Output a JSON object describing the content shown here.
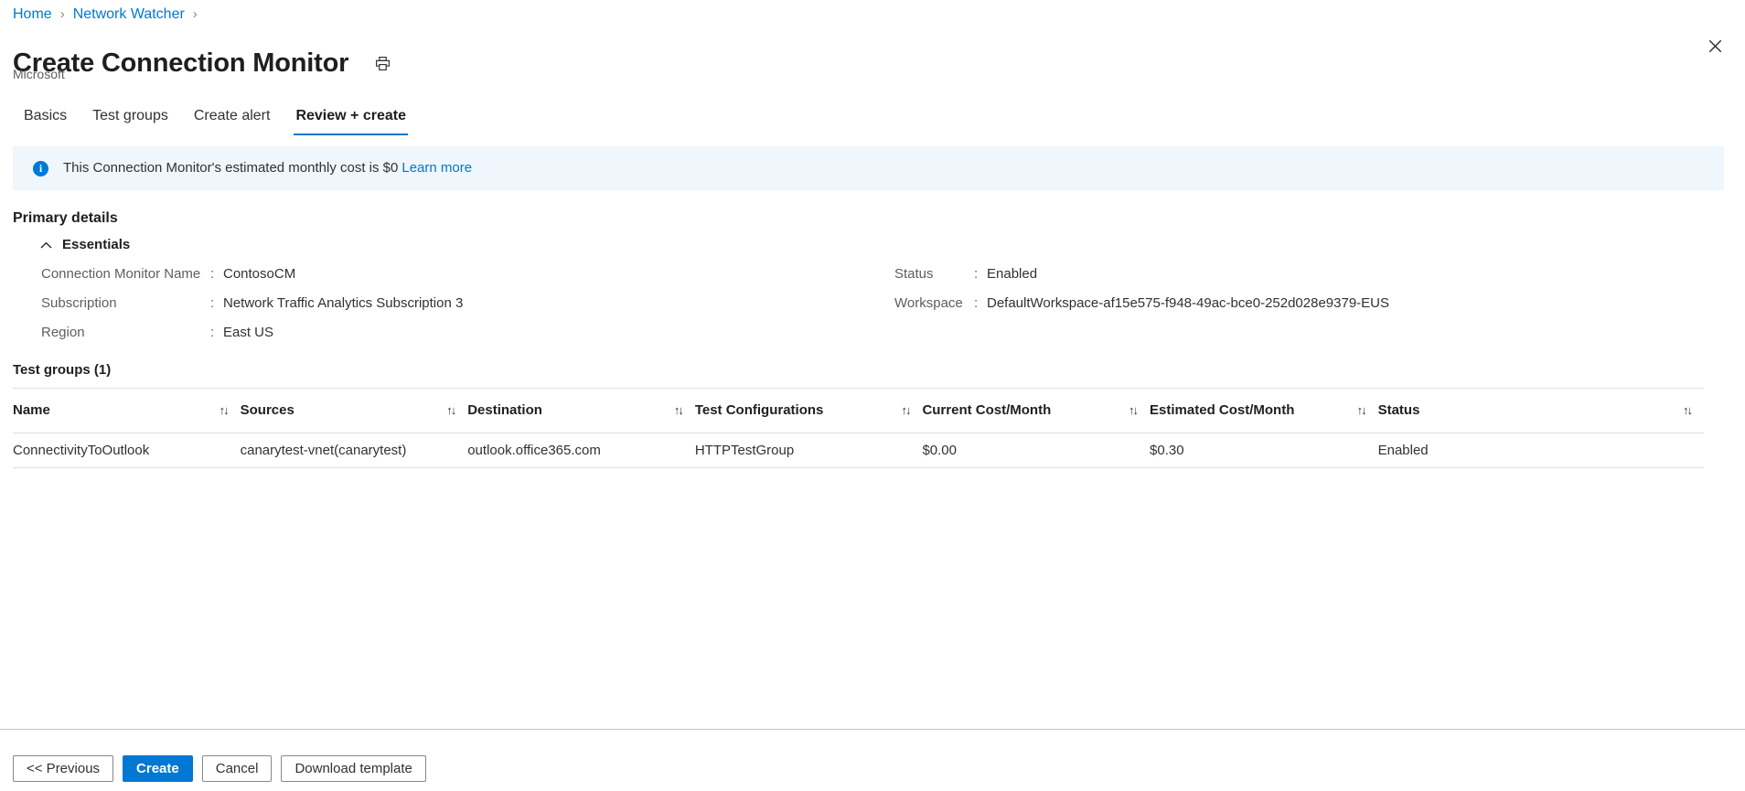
{
  "breadcrumb": {
    "items": [
      {
        "label": "Home"
      },
      {
        "label": "Network Watcher"
      }
    ],
    "separator": "›"
  },
  "header": {
    "title": "Create Connection Monitor",
    "publisher": "Microsoft",
    "print_icon": "print-icon",
    "close_icon": "close-icon"
  },
  "tabs": [
    {
      "label": "Basics",
      "active": false
    },
    {
      "label": "Test groups",
      "active": false
    },
    {
      "label": "Create alert",
      "active": false
    },
    {
      "label": "Review + create",
      "active": true
    }
  ],
  "info_bar": {
    "icon": "info-icon",
    "icon_glyph": "i",
    "text": "This Connection Monitor's estimated monthly cost is $0",
    "link_label": "Learn more",
    "background": "#eff6fc",
    "accent": "#0078d4"
  },
  "primary_details": {
    "section_label": "Primary details",
    "essentials_label": "Essentials",
    "chevron_icon": "chevron-up-icon",
    "left_column": [
      {
        "key": "Connection Monitor Name",
        "colon": ":",
        "value": "ContosoCM"
      },
      {
        "key": "Subscription",
        "colon": ":",
        "value": "Network Traffic Analytics Subscription 3"
      },
      {
        "key": "Region",
        "colon": ":",
        "value": "East US"
      }
    ],
    "right_column": [
      {
        "key": "Status",
        "colon": ":",
        "value": "Enabled"
      },
      {
        "key": "Workspace",
        "colon": ":",
        "value": "DefaultWorkspace-af15e575-f948-49ac-bce0-252d028e9379-EUS"
      }
    ]
  },
  "test_groups": {
    "title": "Test groups (1)",
    "sort_icon": "↑↓",
    "columns": [
      "Name",
      "Sources",
      "Destination",
      "Test Configurations",
      "Current Cost/Month",
      "Estimated Cost/Month",
      "Status"
    ],
    "rows": [
      {
        "name": "ConnectivityToOutlook",
        "sources": "canarytest-vnet(canarytest)",
        "destination": "outlook.office365.com",
        "test_configurations": "HTTPTestGroup",
        "current_cost": "$0.00",
        "estimated_cost": "$0.30",
        "status": "Enabled"
      }
    ]
  },
  "footer": {
    "buttons": [
      {
        "label": "<< Previous",
        "kind": "default",
        "name": "previous-button"
      },
      {
        "label": "Create",
        "kind": "primary",
        "name": "create-button"
      },
      {
        "label": "Cancel",
        "kind": "default",
        "name": "cancel-button"
      },
      {
        "label": "Download template",
        "kind": "default",
        "name": "download-template-button"
      }
    ]
  },
  "colors": {
    "accent": "#0078d4",
    "link": "#0078d4",
    "text": "#323130",
    "muted": "#605e5c",
    "border": "#e1dfdd"
  }
}
